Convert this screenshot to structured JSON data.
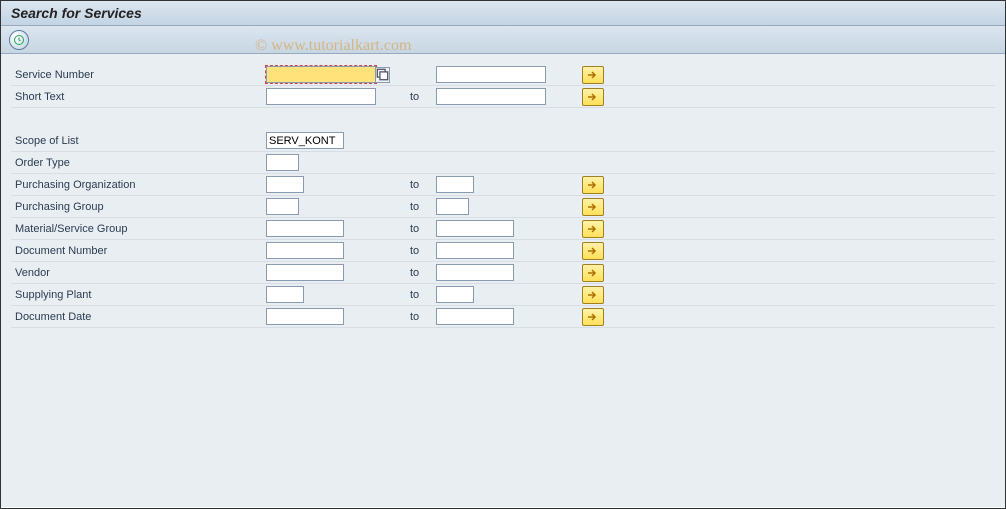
{
  "title": "Search for Services",
  "watermark": "© www.tutorialkart.com",
  "rows": {
    "service_number": {
      "label": "Service Number",
      "from": "",
      "to_label": "",
      "to": ""
    },
    "short_text": {
      "label": "Short Text",
      "from": "",
      "to_label": "to",
      "to": ""
    },
    "scope_of_list": {
      "label": "Scope of List",
      "value": "SERV_KONT"
    },
    "order_type": {
      "label": "Order Type",
      "value": ""
    },
    "purch_org": {
      "label": "Purchasing Organization",
      "from": "",
      "to_label": "to",
      "to": ""
    },
    "purch_group": {
      "label": "Purchasing Group",
      "from": "",
      "to_label": "to",
      "to": ""
    },
    "mat_serv_group": {
      "label": "Material/Service Group",
      "from": "",
      "to_label": "to",
      "to": ""
    },
    "doc_number": {
      "label": "Document Number",
      "from": "",
      "to_label": "to",
      "to": ""
    },
    "vendor": {
      "label": "Vendor",
      "from": "",
      "to_label": "to",
      "to": ""
    },
    "supplying_plant": {
      "label": "Supplying Plant",
      "from": "",
      "to_label": "to",
      "to": ""
    },
    "doc_date": {
      "label": "Document Date",
      "from": "",
      "to_label": "to",
      "to": ""
    }
  }
}
